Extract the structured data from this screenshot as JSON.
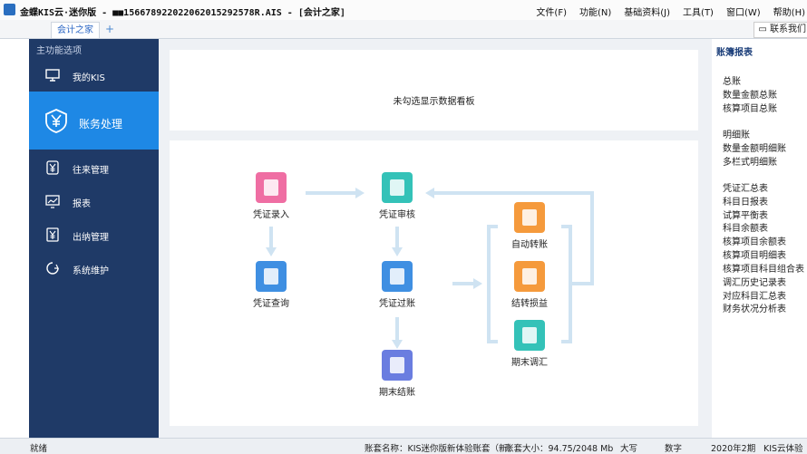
{
  "titlebar": {
    "title": "金蝶KIS云·迷你版 - ■■156678922022062015292578R.AIS - [会计之家]",
    "menu": [
      "文件(F)",
      "功能(N)",
      "基础资料(J)",
      "工具(T)",
      "窗口(W)",
      "帮助(H)"
    ]
  },
  "tabs": {
    "active": "会计之家",
    "add": "+",
    "contact": "联系我们"
  },
  "sidebar": {
    "header": "主功能选项",
    "items": [
      {
        "label": "我的KIS",
        "icon": "monitor-icon"
      },
      {
        "label": "账务处理",
        "icon": "yen-icon"
      },
      {
        "label": "往来管理",
        "icon": "yen-icon"
      },
      {
        "label": "报表",
        "icon": "chart-icon"
      },
      {
        "label": "出纳管理",
        "icon": "yen-icon"
      },
      {
        "label": "系统维护",
        "icon": "cycle-icon"
      }
    ]
  },
  "dashboard": {
    "message": "未勾选显示数据看板"
  },
  "flow": {
    "nodes": [
      {
        "label": "凭证录入",
        "color": "#ef6ea3"
      },
      {
        "label": "凭证审核",
        "color": "#34c2b8"
      },
      {
        "label": "凭证查询",
        "color": "#3f8fe2"
      },
      {
        "label": "凭证过账",
        "color": "#3f8fe2"
      },
      {
        "label": "期末结账",
        "color": "#6a7de0"
      },
      {
        "label": "自动转账",
        "color": "#f59a3c"
      },
      {
        "label": "结转损益",
        "color": "#f59a3c"
      },
      {
        "label": "期末调汇",
        "color": "#34c2b8"
      }
    ]
  },
  "right_panel": {
    "title": "账簿报表",
    "groups": [
      [
        "总账",
        "数量金额总账",
        "核算项目总账"
      ],
      [
        "明细账",
        "数量金额明细账",
        "多栏式明细账"
      ],
      [
        "凭证汇总表",
        "科目日报表",
        "试算平衡表",
        "科目余额表",
        "核算项目余额表",
        "核算项目明细表",
        "核算项目科目组合表",
        "调汇历史记录表",
        "对应科目汇总表",
        "财务状况分析表"
      ]
    ]
  },
  "status": {
    "ready": "就绪",
    "account": "账套名称：KIS迷你版新体验账套（新）",
    "size": "账套大小：94.75/2048 Mb",
    "caps": "大写",
    "num": "数字",
    "period": "2020年2期",
    "product": "KIS云体验"
  }
}
